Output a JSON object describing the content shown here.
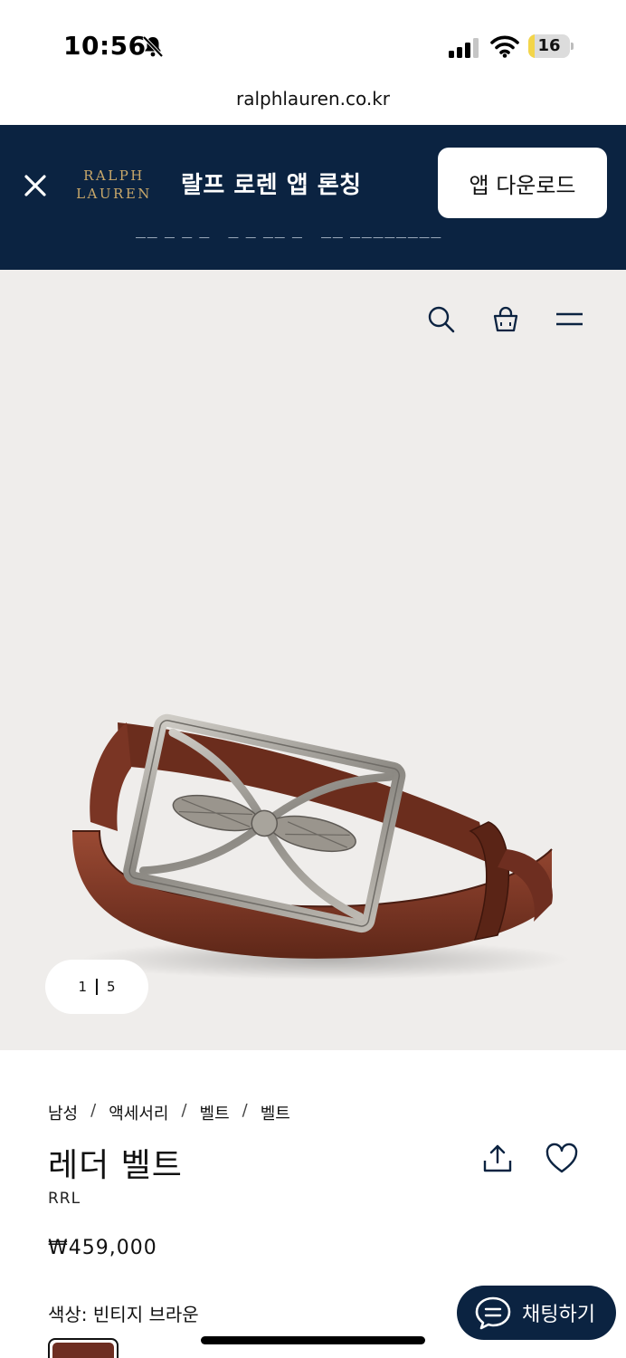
{
  "status_bar": {
    "time": "10:56",
    "battery_level": 16,
    "battery_label": "16",
    "icons": [
      "bell-slash-icon",
      "signal-icon",
      "wifi-icon",
      "battery-icon"
    ],
    "battery_color": "#f3d54a"
  },
  "browser": {
    "url": "ralphlauren.co.kr"
  },
  "app_banner": {
    "brand_line1": "RALPH",
    "brand_line2": "LAUREN",
    "title": "랄프 로렌 앱 론칭",
    "download_label": "앱 다운로드",
    "background_color": "#0b2341",
    "logo_color": "#c9a86a"
  },
  "header_icons": [
    "search-icon",
    "shopping-bag-icon",
    "menu-icon"
  ],
  "gallery": {
    "current": "1",
    "total": "5",
    "background_color": "#efedeb"
  },
  "product": {
    "breadcrumb": [
      "남성",
      "액세서리",
      "벨트",
      "벨트"
    ],
    "separator": "/",
    "title": "레더 벨트",
    "brand": "RRL",
    "price": "₩459,000",
    "color_label": "색상: 빈티지 브라운",
    "swatch_color": "#6e2e22"
  },
  "chat": {
    "label": "채팅하기",
    "background_color": "#0b2341"
  }
}
